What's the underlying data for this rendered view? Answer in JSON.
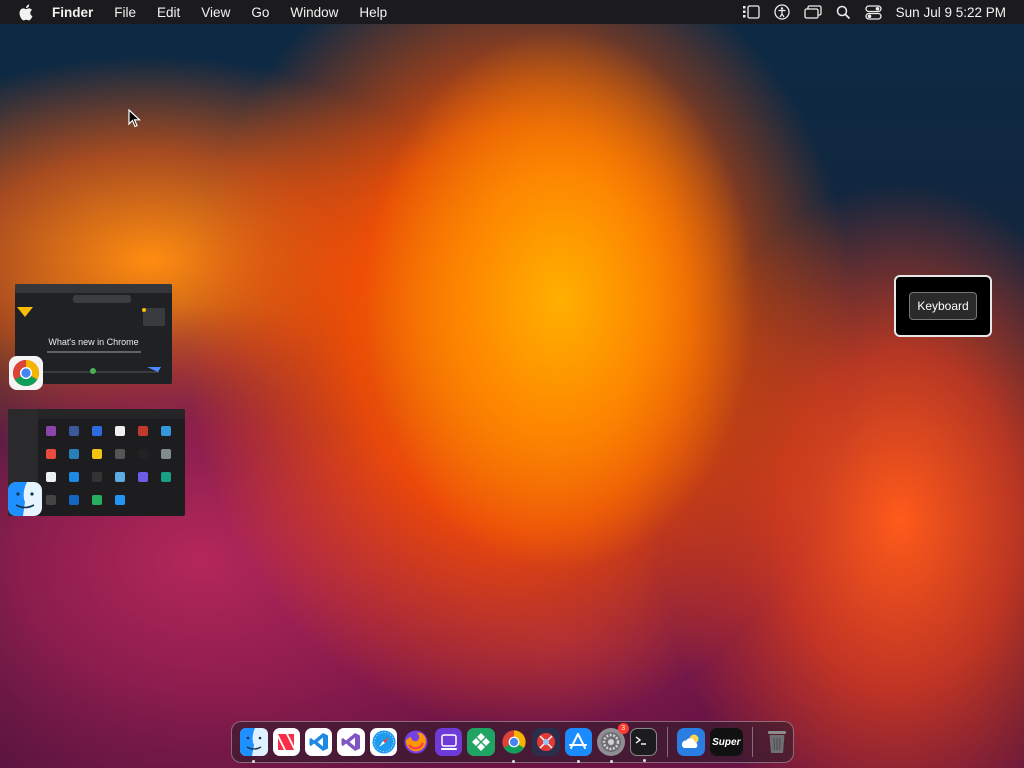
{
  "menubar": {
    "app_name": "Finder",
    "menus": [
      "File",
      "Edit",
      "View",
      "Go",
      "Window",
      "Help"
    ],
    "clock": "Sun Jul 9  5:22 PM",
    "status_icons": [
      "stage-manager-icon",
      "accessibility-icon",
      "screen-mirroring-icon",
      "spotlight-search-icon",
      "control-center-icon"
    ]
  },
  "switcher": {
    "chrome_window_heading": "What's new in Chrome",
    "chrome_app": "chrome-icon",
    "finder_app": "finder-icon"
  },
  "keyboard_overlay": {
    "label": "Keyboard"
  },
  "dock": {
    "super_label": "Super",
    "notification_badge": "3",
    "apps": [
      "finder",
      "news",
      "vscode",
      "visual-studio",
      "safari",
      "firefox",
      "stage",
      "app-green",
      "chrome",
      "app-red",
      "app-store",
      "system-settings",
      "terminal",
      "weather",
      "super",
      "trash"
    ]
  },
  "colors": {
    "menubar_bg": "#1b1b1e",
    "wallpaper_orange": "#ff7a00",
    "wallpaper_magenta": "#8a1f4f"
  }
}
